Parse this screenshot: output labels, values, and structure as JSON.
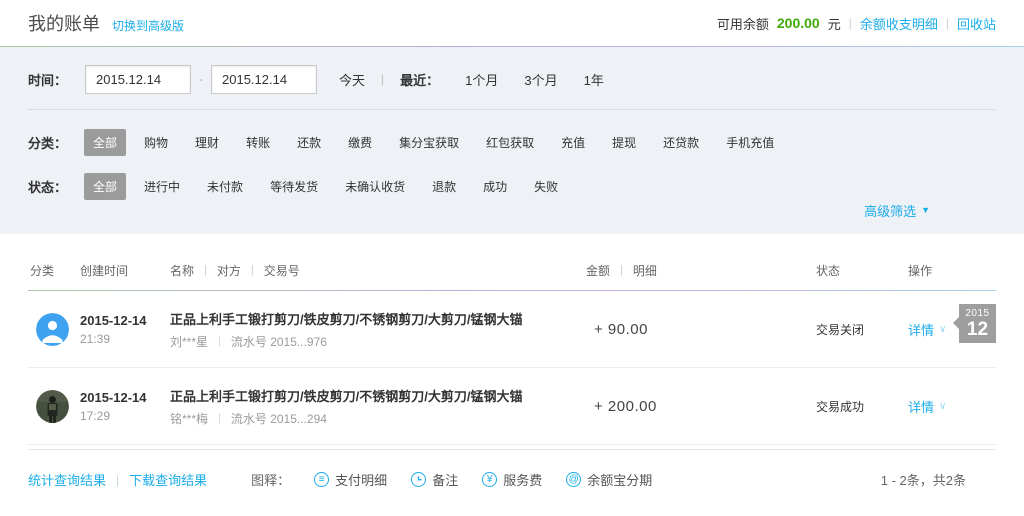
{
  "header": {
    "title": "我的账单",
    "switch_link": "切换到高级版",
    "balance_label": "可用余额",
    "balance_value": "200.00",
    "balance_unit": "元",
    "balance_detail_link": "余额收支明细",
    "recycle_link": "回收站"
  },
  "filters": {
    "time_label": "时间：",
    "date_from": "2015.12.14",
    "date_to": "2015.12.14",
    "today": "今天",
    "recent_label": "最近：",
    "recent_options": [
      "1个月",
      "3个月",
      "1年"
    ],
    "category_label": "分类：",
    "categories": [
      "全部",
      "购物",
      "理财",
      "转账",
      "还款",
      "缴费",
      "集分宝获取",
      "红包获取",
      "充值",
      "提现",
      "还贷款",
      "手机充值"
    ],
    "status_label": "状态：",
    "statuses": [
      "全部",
      "进行中",
      "未付款",
      "等待发货",
      "未确认收货",
      "退款",
      "成功",
      "失败"
    ],
    "advanced_filter": "高级筛选"
  },
  "table": {
    "headers": {
      "category": "分类",
      "created": "创建时间",
      "name": "名称",
      "party": "对方",
      "txn": "交易号",
      "amount": "金额",
      "detail": "明细",
      "status": "状态",
      "action": "操作"
    },
    "rows": [
      {
        "avatar": "person-icon-blue",
        "date": "2015-12-14",
        "time": "21:39",
        "title": "正品上利手工锻打剪刀/铁皮剪刀/不锈钢剪刀/大剪刀/锰钢大锚",
        "party": "刘***星",
        "serial": "流水号 2015...976",
        "amount": "+ 90.00",
        "status": "交易关闭",
        "action": "详情"
      },
      {
        "avatar": "photo-avatar-dark",
        "date": "2015-12-14",
        "time": "17:29",
        "title": "正品上利手工锻打剪刀/铁皮剪刀/不锈钢剪刀/大剪刀/锰钢大锚",
        "party": "铭***梅",
        "serial": "流水号 2015...294",
        "amount": "+ 200.00",
        "status": "交易成功",
        "action": "详情"
      }
    ],
    "date_badge": {
      "year": "2015",
      "month": "12"
    }
  },
  "footer": {
    "stats_link": "统计查询结果",
    "download_link": "下载查询结果",
    "legend_label": "图释：",
    "legend_items": [
      {
        "icon": "payment-detail-icon",
        "glyph": "≡",
        "label": "支付明细"
      },
      {
        "icon": "note-icon",
        "glyph": "clock-hands",
        "label": "备注"
      },
      {
        "icon": "service-fee-icon",
        "glyph": "¥",
        "label": "服务费"
      },
      {
        "icon": "yeb-installment-icon",
        "glyph": "@",
        "label": "余额宝分期"
      }
    ],
    "pagination": "1 - 2条，共2条"
  },
  "colors": {
    "link": "#1badea",
    "green": "#3fa90a",
    "panel": "#eef1f5",
    "tab-sel": "#9b9b9b",
    "badge": "#9e9e9e",
    "avatar-blue": "#3da2f0"
  }
}
